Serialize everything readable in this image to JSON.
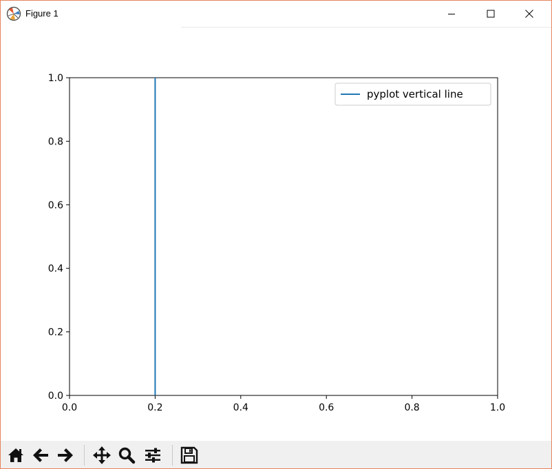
{
  "window": {
    "title": "Figure 1",
    "border_color": "#e8825e"
  },
  "title_buttons": [
    {
      "name": "minimize-icon"
    },
    {
      "name": "maximize-icon"
    },
    {
      "name": "close-icon"
    }
  ],
  "chart_data": {
    "type": "line",
    "title": "",
    "xlabel": "",
    "ylabel": "",
    "xlim": [
      0.0,
      1.0
    ],
    "ylim": [
      0.0,
      1.0
    ],
    "xticks": [
      "0.0",
      "0.2",
      "0.4",
      "0.6",
      "0.8",
      "1.0"
    ],
    "yticks": [
      "0.0",
      "0.2",
      "0.4",
      "0.6",
      "0.8",
      "1.0"
    ],
    "grid": false,
    "legend_position": "upper right",
    "series": [
      {
        "name": "pyplot vertical line",
        "x": [
          0.2,
          0.2
        ],
        "y": [
          0.0,
          1.0
        ],
        "color": "#1f77b4"
      }
    ]
  },
  "toolbar": {
    "buttons": [
      {
        "name": "home-icon"
      },
      {
        "name": "back-arrow-icon"
      },
      {
        "name": "forward-arrow-icon"
      },
      {
        "name": "pan-move-icon"
      },
      {
        "name": "zoom-magnifier-icon"
      },
      {
        "name": "configure-subplots-icon"
      },
      {
        "name": "save-floppy-icon"
      }
    ]
  }
}
